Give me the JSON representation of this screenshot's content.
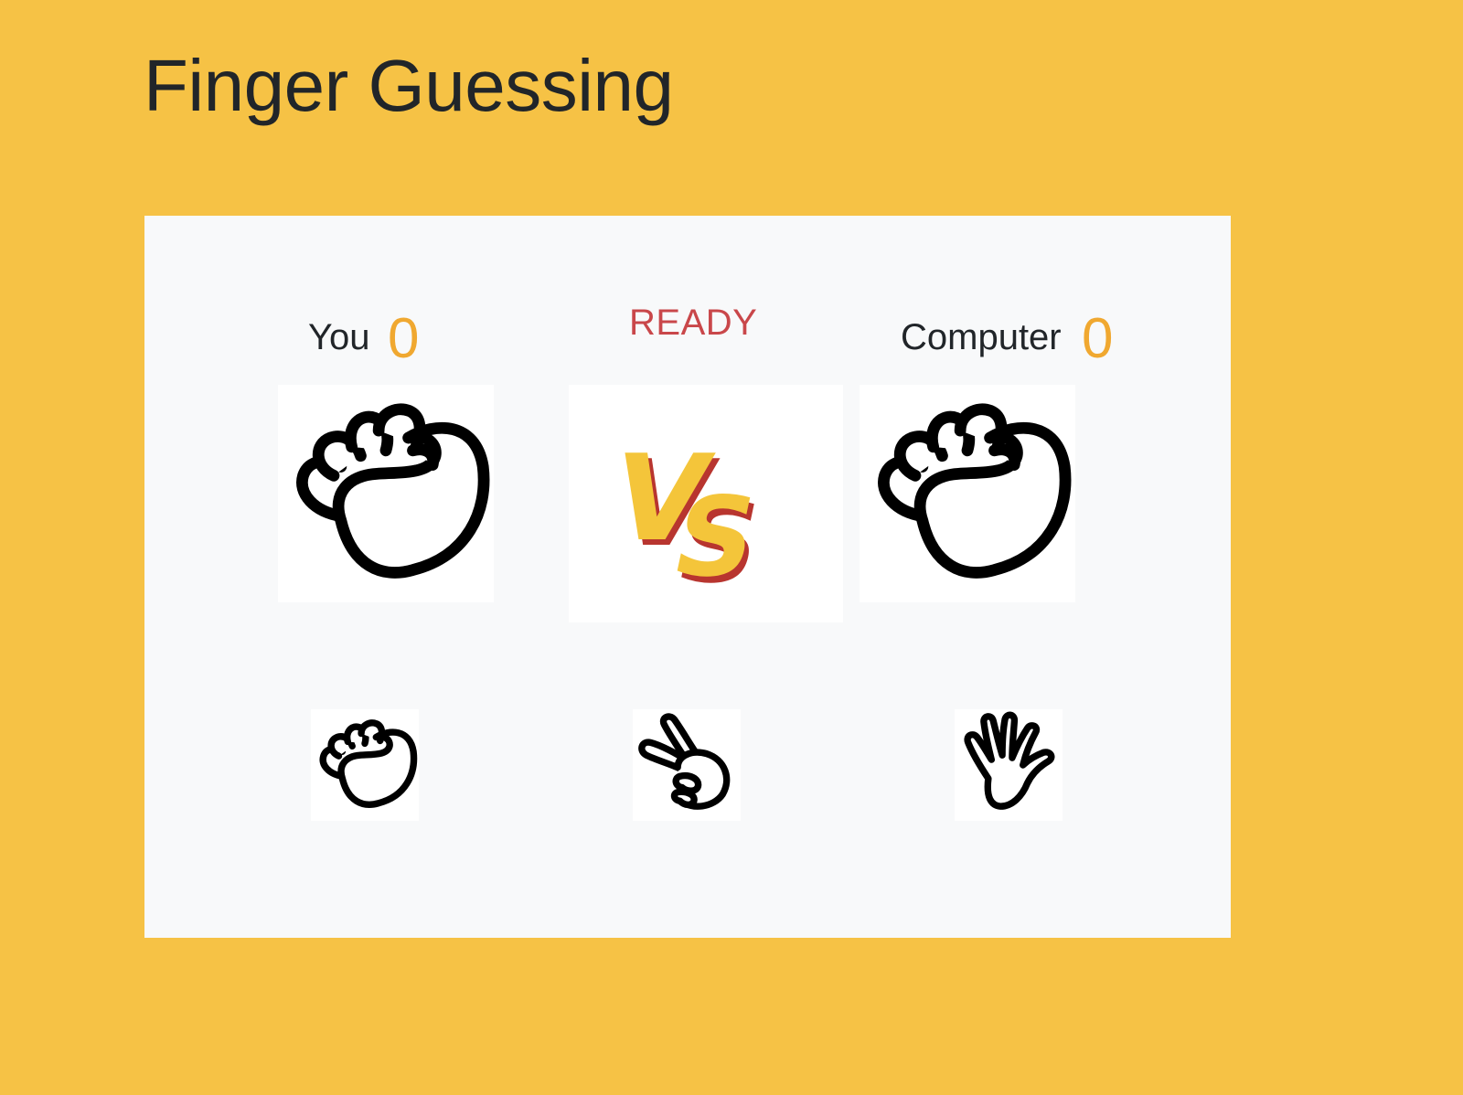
{
  "page": {
    "title": "Finger Guessing"
  },
  "game": {
    "player_label": "You",
    "player_score": "0",
    "computer_label": "Computer",
    "computer_score": "0",
    "status": "READY",
    "player_hand": "rock-hand-icon",
    "computer_hand": "rock-hand-icon",
    "vs_text": "VS"
  },
  "choices": [
    {
      "icon": "rock-hand-icon"
    },
    {
      "icon": "scissors-hand-icon"
    },
    {
      "icon": "paper-hand-icon"
    }
  ],
  "colors": {
    "background": "#f6c245",
    "board": "#f8f9fa",
    "score": "#f0a830",
    "status": "#c9474a",
    "vs_yellow": "#f4c53a",
    "vs_red": "#b8352f"
  }
}
